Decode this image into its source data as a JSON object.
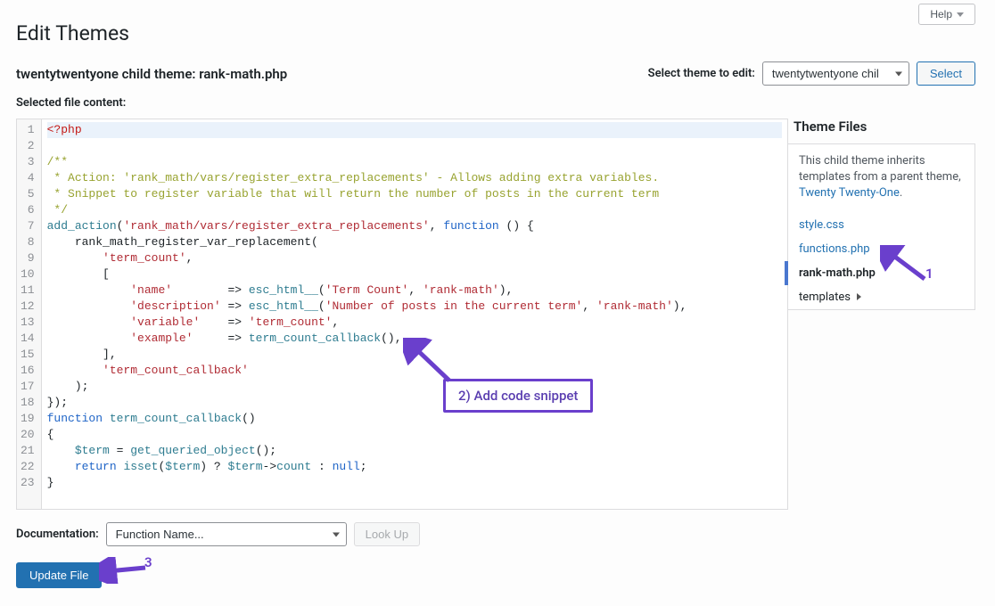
{
  "help": {
    "label": "Help"
  },
  "page": {
    "title": "Edit Themes",
    "subtitle": "twentytwentyone child theme: rank-math.php",
    "selected_file_label": "Selected file content:"
  },
  "theme_selector": {
    "label": "Select theme to edit:",
    "selected": "twentytwentyone chil",
    "select_button": "Select"
  },
  "sidebar": {
    "title": "Theme Files",
    "desc_prefix": "This child theme inherits templates from a parent theme, ",
    "parent_link": "Twenty Twenty-One",
    "desc_suffix": ".",
    "files": [
      {
        "name": "style.css",
        "active": false
      },
      {
        "name": "functions.php",
        "active": false
      },
      {
        "name": "rank-math.php",
        "active": true
      },
      {
        "name": "templates",
        "folder": true
      }
    ]
  },
  "code": {
    "lines": [
      {
        "n": 1,
        "hl": true,
        "html": "<span class='tok-meta'>&lt;?php</span>"
      },
      {
        "n": 2,
        "html": ""
      },
      {
        "n": 3,
        "html": "<span class='tok-com'>/**</span>"
      },
      {
        "n": 4,
        "html": "<span class='tok-com'> * Action: 'rank_math/vars/register_extra_replacements' - Allows adding extra variables.</span>"
      },
      {
        "n": 5,
        "html": "<span class='tok-com'> * Snippet to register variable that will return the number of posts in the current term</span>"
      },
      {
        "n": 6,
        "html": "<span class='tok-com'> */</span>"
      },
      {
        "n": 7,
        "html": "<span class='tok-var'>add_action</span>(<span class='tok-str'>'rank_math/vars/register_extra_replacements'</span>, <span class='tok-kw'>function</span> () {"
      },
      {
        "n": 8,
        "html": "    rank_math_register_var_replacement("
      },
      {
        "n": 9,
        "html": "        <span class='tok-str'>'term_count'</span>,"
      },
      {
        "n": 10,
        "html": "        ["
      },
      {
        "n": 11,
        "html": "            <span class='tok-key'>'name'</span>        =&gt; <span class='tok-var'>esc_html__</span>(<span class='tok-str'>'Term Count'</span>, <span class='tok-str'>'rank-math'</span>),"
      },
      {
        "n": 12,
        "html": "            <span class='tok-key'>'description'</span> =&gt; <span class='tok-var'>esc_html__</span>(<span class='tok-str'>'Number of posts in the current term'</span>, <span class='tok-str'>'rank-math'</span>),"
      },
      {
        "n": 13,
        "html": "            <span class='tok-key'>'variable'</span>    =&gt; <span class='tok-str'>'term_count'</span>,"
      },
      {
        "n": 14,
        "html": "            <span class='tok-key'>'example'</span>     =&gt; <span class='tok-var'>term_count_callback</span>(),"
      },
      {
        "n": 15,
        "html": "        ],"
      },
      {
        "n": 16,
        "html": "        <span class='tok-str'>'term_count_callback'</span>"
      },
      {
        "n": 17,
        "html": "    );"
      },
      {
        "n": 18,
        "html": "});"
      },
      {
        "n": 19,
        "html": "<span class='tok-kw'>function</span> <span class='tok-var'>term_count_callback</span>()"
      },
      {
        "n": 20,
        "html": "{"
      },
      {
        "n": 21,
        "html": "    <span class='tok-att'>$term</span> = <span class='tok-var'>get_queried_object</span>();"
      },
      {
        "n": 22,
        "html": "    <span class='tok-kw'>return</span> <span class='tok-var'>isset</span>(<span class='tok-att'>$term</span>) ? <span class='tok-att'>$term</span>-&gt;<span class='tok-var'>count</span> : <span class='tok-kw'>null</span>;"
      },
      {
        "n": 23,
        "html": "}"
      }
    ]
  },
  "documentation": {
    "label": "Documentation:",
    "placeholder": "Function Name...",
    "lookup": "Look Up"
  },
  "update": {
    "label": "Update File"
  },
  "annotations": {
    "callout": "2) Add code snippet",
    "num1": "1",
    "num3": "3"
  }
}
